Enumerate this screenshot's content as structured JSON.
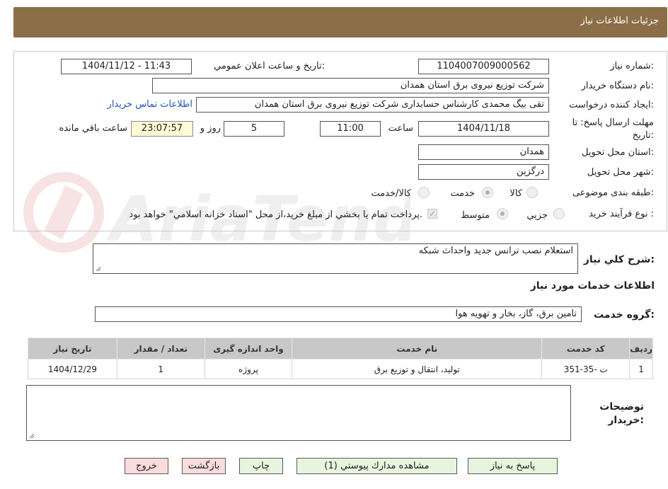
{
  "header": {
    "title": "جزئيات اطلاعات نياز"
  },
  "form": {
    "need_number_label": "شماره نياز:",
    "need_number": "1104007009000562",
    "announce_label": "تاريخ و ساعت اعلان عمومي:",
    "announce_value": "1404/11/12 - 11:43",
    "buyer_org_label": "نام دستگاه خريدار:",
    "buyer_org": "شرکت توزیع نیروی برق استان همدان",
    "requester_label": "ايجاد کننده درخواست:",
    "requester": "تقی بیگ محمدی کارشناس حسابداری شرکت توزیع نیروی برق استان همدان",
    "contact_link": "اطلاعات تماس خريدار",
    "deadline_label_1": "مهلت ارسال پاسخ: تا",
    "deadline_label_2": "تاريخ:",
    "deadline_date": "1404/11/18",
    "time_label": "ساعت",
    "deadline_time": "11:00",
    "days_value": "5",
    "days_label": "روز و",
    "remaining_time": "23:07:57",
    "remaining_label": "ساعت باقي مانده",
    "province_label": "استان محل تحويل:",
    "province": "همدان",
    "city_label": "شهر محل تحويل:",
    "city": "درگزین",
    "category_label": "طبقه بندی موضوعی:",
    "category_options": [
      "کالا",
      "خدمت",
      "کالا/خدمت"
    ],
    "category_selected": "خدمت",
    "process_label": "نوع فرآيند خريد :",
    "process_options": [
      "جزيي",
      "متوسط"
    ],
    "process_selected": "متوسط",
    "payment_note": "پرداخت تمام يا بخشي از مبلغ خريد،از محل \"اسناد خزانه اسلامي\" خواهد بود."
  },
  "description": {
    "label": "شرح كلي نياز:",
    "value": "استعلام نصب ترانس جدید واحداث شبکه"
  },
  "services_section": {
    "title": "اطلاعات خدمات مورد نياز",
    "group_label": "گروه خدمت:",
    "group_value": "تامین برق، گاز، بخار و تهویه هوا"
  },
  "table": {
    "headers": [
      "رديف",
      "کد خدمت",
      "نام خدمت",
      "واحد اندازه گيری",
      "تعداد / مقدار",
      "تاريخ نياز"
    ],
    "rows": [
      [
        "1",
        "ت -35-351",
        "تولید، انتقال و توزیع برق",
        "پروژه",
        "1",
        "1404/12/29"
      ]
    ]
  },
  "buyer_notes": {
    "label_1": "توضيحات",
    "label_2": "خريدار:",
    "value": ""
  },
  "buttons": {
    "reply": "پاسخ به نياز",
    "attachments": "مشاهده مدارك پيوستي (1)",
    "print": "چاپ",
    "back": "بازگشت",
    "exit": "خروج"
  },
  "watermark": {
    "text": "AriaTender.neT"
  },
  "colors": {
    "header_bg": "#8b6e47",
    "link": "#1a56b8",
    "remaining_bg": "#fffbd6",
    "button_green": "#e7f5de",
    "button_pink": "#fbdcdc",
    "table_header_bg": "#c8c8c8"
  }
}
